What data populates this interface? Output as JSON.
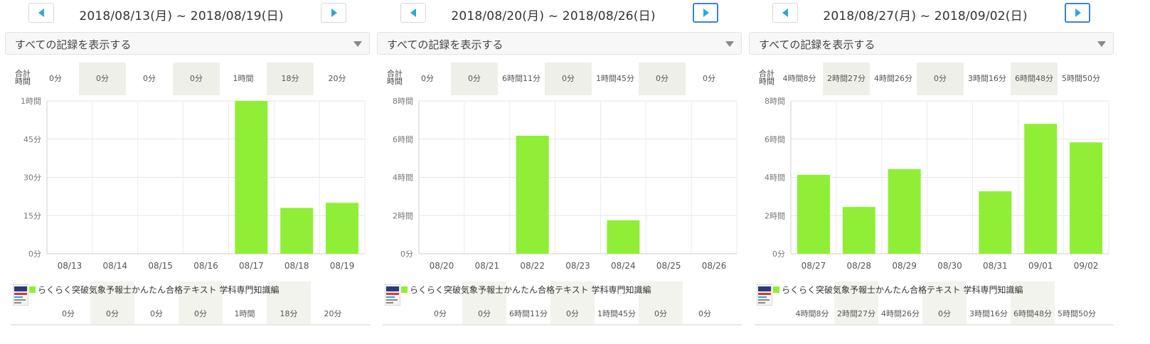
{
  "panels": [
    {
      "date_range": "2018/08/13(月) ~ 2018/08/19(日)",
      "filter_label": "すべての記録を表示する",
      "totals_label": "合計\n時間",
      "totals": [
        "0分",
        "0分",
        "0分",
        "0分",
        "1時間",
        "18分",
        "20分"
      ],
      "book": {
        "title": "らくらく突破気象予報士かんたん合格テキスト 学科専門知識編",
        "values": [
          "0分",
          "0分",
          "0分",
          "0分",
          "1時間",
          "18分",
          "20分"
        ]
      },
      "next_active": false
    },
    {
      "date_range": "2018/08/20(月) ~ 2018/08/26(日)",
      "filter_label": "すべての記録を表示する",
      "totals_label": "合計\n時間",
      "totals": [
        "0分",
        "0分",
        "6時間11分",
        "0分",
        "1時間45分",
        "0分",
        "0分"
      ],
      "book": {
        "title": "らくらく突破気象予報士かんたん合格テキスト 学科専門知識編",
        "values": [
          "0分",
          "0分",
          "6時間11分",
          "0分",
          "1時間45分",
          "0分",
          "0分"
        ]
      },
      "next_active": true
    },
    {
      "date_range": "2018/08/27(月) ~ 2018/09/02(日)",
      "filter_label": "すべての記録を表示する",
      "totals_label": "合計\n時間",
      "totals": [
        "4時間8分",
        "2時間27分",
        "4時間26分",
        "0分",
        "3時間16分",
        "6時間48分",
        "5時間50分"
      ],
      "book": {
        "title": "らくらく突破気象予報士かんたん合格テキスト 学科専門知識編",
        "values": [
          "4時間8分",
          "2時間27分",
          "4時間26分",
          "0分",
          "3時間16分",
          "6時間48分",
          "5時間50分"
        ]
      },
      "next_active": true
    }
  ],
  "colors": {
    "bar": "#90ee36",
    "accent": "#2aa8e0",
    "active_border": "#3a82d6"
  },
  "icons": {
    "prev": "caret-left-icon",
    "next": "caret-right-icon",
    "dropdown": "chevron-down-icon",
    "book": "book-cover-icon"
  },
  "chart_data": [
    {
      "type": "bar",
      "categories": [
        "08/13",
        "08/14",
        "08/15",
        "08/16",
        "08/17",
        "08/18",
        "08/19"
      ],
      "values": [
        0,
        0,
        0,
        0,
        60,
        18,
        20
      ],
      "y_ticks": [
        0,
        15,
        30,
        45,
        60
      ],
      "y_tick_labels": [
        "0分",
        "15分",
        "30分",
        "45分",
        "1時間"
      ],
      "ylim": [
        0,
        60
      ],
      "grid": true
    },
    {
      "type": "bar",
      "categories": [
        "08/20",
        "08/21",
        "08/22",
        "08/23",
        "08/24",
        "08/25",
        "08/26"
      ],
      "values": [
        0,
        0,
        6.18,
        0,
        1.75,
        0,
        0
      ],
      "y_ticks": [
        0,
        2,
        4,
        6,
        8
      ],
      "y_tick_labels": [
        "0分",
        "2時間",
        "4時間",
        "6時間",
        "8時間"
      ],
      "ylim": [
        0,
        8
      ],
      "grid": true
    },
    {
      "type": "bar",
      "categories": [
        "08/27",
        "08/28",
        "08/29",
        "08/30",
        "08/31",
        "09/01",
        "09/02"
      ],
      "values": [
        4.13,
        2.45,
        4.43,
        0,
        3.27,
        6.8,
        5.83
      ],
      "y_ticks": [
        0,
        2,
        4,
        6,
        8
      ],
      "y_tick_labels": [
        "0分",
        "2時間",
        "4時間",
        "6時間",
        "8時間"
      ],
      "ylim": [
        0,
        8
      ],
      "grid": true
    }
  ]
}
